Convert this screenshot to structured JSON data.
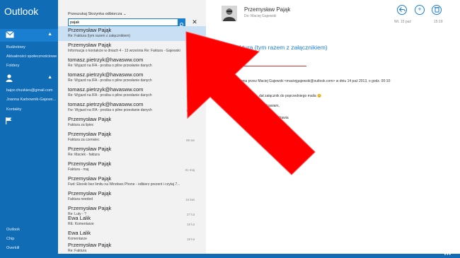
{
  "app": {
    "title": "Outlook"
  },
  "nav": {
    "items": [
      {
        "label": "Budżetowy"
      },
      {
        "label": "Aktualności społecznościowe"
      },
      {
        "label": "Foldery"
      }
    ],
    "accounts": [
      {
        "label": "bajor.chuskies@gmail.com"
      },
      {
        "label": "Joanna Karbownik-Gajews..."
      },
      {
        "label": "Kontakty"
      }
    ],
    "bottom": [
      {
        "label": "Outlook"
      },
      {
        "label": "Chip"
      },
      {
        "label": "Overkill"
      }
    ]
  },
  "list": {
    "folder_head": "Przeszukaj Skrzynka odbiorcza ⌄",
    "search_value": "pajak",
    "messages": [
      {
        "from": "Przemysław Pająk",
        "subject": "Re: Faktura (tym razem z załącznikiem)",
        "date": ""
      },
      {
        "from": "Przemysław Pająk",
        "subject": "Informacja o kontakcie w dniach 4 - 13 września Re: Faktura - Gajewski",
        "date": ""
      },
      {
        "from": "tomasz.pietrzyk@havasww.com",
        "subject": "Re: Wyjazd na IFA - prośba o pilne przesłanie danych",
        "date": "26 sie"
      },
      {
        "from": "tomasz.pietrzyk@havasww.com",
        "subject": "Re: Wyjazd na IFA - prośba o pilne przesłanie danych",
        "date": "14 sie"
      },
      {
        "from": "tomasz.pietrzyk@havasww.com",
        "subject": "Re: Wyjazd na IFA - prośba o pilne przesłanie danych",
        "date": "14 sie"
      },
      {
        "from": "tomasz.pietrzyk@havasww.com",
        "subject": "Fw: Wyjazd na IFA - prośba o pilne przesłanie danych",
        "date": "14 sie"
      },
      {
        "from": "Przemysław Pająk",
        "subject": "Faktura za lipiec",
        "date": ""
      },
      {
        "from": "Przemysław Pająk",
        "subject": "Faktura za czerwiec",
        "date": "09 sie"
      },
      {
        "from": "Przemysław Pająk",
        "subject": "Re: Maciek - faktura",
        "date": ""
      },
      {
        "from": "Przemysław Pająk",
        "subject": "Faktura - maj",
        "date": "31 maj"
      },
      {
        "from": "Przemysław Pająk",
        "subject": "Fwd: Ebooki bez limitu na Windows Phone - odbierz prezent i czytaj 7...",
        "date": ""
      },
      {
        "from": "Przemysław Pająk",
        "subject": "Faktura needed",
        "date": "16 kwi"
      },
      {
        "from": "Przemysław Pająk",
        "subject": "Re: Luty - ?",
        "date": "27 lut"
      },
      {
        "from": "Ewa Lalik",
        "subject": "RE: Komentarze",
        "date": "18 lut"
      },
      {
        "from": "Ewa Lalik",
        "subject": "Komentarze",
        "date": "18 lut"
      },
      {
        "from": "Przemysław Pająk",
        "subject": "Re: Faktura",
        "date": ""
      }
    ]
  },
  "read": {
    "sender": "Przemysław Pająk",
    "to": "Do: Maciej Gajewski",
    "date": "Wt. 15 paź",
    "time": "15:19",
    "subject": "Re: Faktura (tym razem z załącznikiem)",
    "body": [
      "Proszę wykonana,",
      "ana przez Maciej Gajewski <maciejgajewski@outlook.com> w dniu 14 paź 2013, o godz. 00:10:",
      "dał załącznik do poprzedniego maila 😊",
      "Pozdrawiam,",
      "Maciej",
      "-Maciek pozdrawia"
    ]
  },
  "colors": {
    "accent": "#1a7fd0",
    "nav_bg": "#0f6cb5",
    "arrow": "#ff0000"
  }
}
